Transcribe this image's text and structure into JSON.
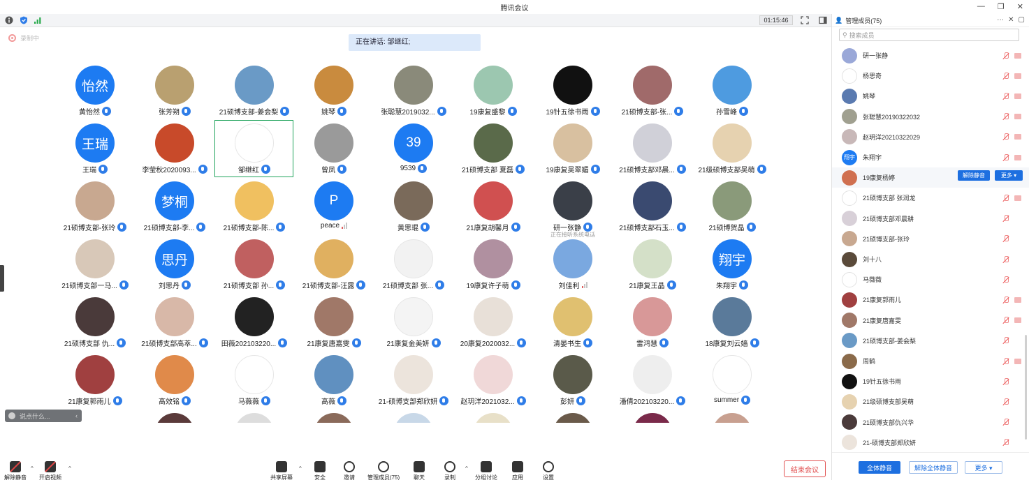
{
  "window": {
    "title": "腾讯会议"
  },
  "topbar": {
    "timer": "01:15:46"
  },
  "recording": {
    "label": "录制中"
  },
  "speaking": {
    "label": "正在讲话: 邹继红;"
  },
  "tiles": [
    {
      "name": "黄怡然",
      "avatar_text": "怡然",
      "color": "#1d7bf2"
    },
    {
      "name": "张芳朔",
      "color": "#b9a070"
    },
    {
      "name": "21硕博支部-姜会梨",
      "color": "#6a9ac6"
    },
    {
      "name": "姚琴",
      "color": "#c98b3e"
    },
    {
      "name": "张聪慧2019032...",
      "color": "#8a8a7a"
    },
    {
      "name": "19康复盛黎",
      "color": "#9cc7b0"
    },
    {
      "name": "19针五徐书雨",
      "color": "#111111"
    },
    {
      "name": "21硕博支部-张...",
      "color": "#a06a6a"
    },
    {
      "name": "孙雪峰",
      "color": "#4e9be0"
    },
    {
      "name": "王瑞",
      "avatar_text": "王瑞",
      "color": "#1d7bf2"
    },
    {
      "name": "李莹秋2020093...",
      "color": "#c84a2a"
    },
    {
      "name": "邹继红",
      "color": "#ffffff"
    },
    {
      "name": "曾凤",
      "color": "#9a9a9a"
    },
    {
      "name": "9539",
      "avatar_text": "39",
      "color": "#1d7bf2"
    },
    {
      "name": "21硕博支部 夏磊",
      "color": "#5a6a4a"
    },
    {
      "name": "19康复吴翠媚",
      "color": "#d8c0a0"
    },
    {
      "name": "21硕博支部邓晨...",
      "color": "#d0d0d8"
    },
    {
      "name": "21级硕博支部吴萌",
      "color": "#e6d2b0"
    },
    {
      "name": "21硕博支部-张玲",
      "color": "#c8a890"
    },
    {
      "name": "21硕博支部-李...",
      "avatar_text": "梦桐",
      "color": "#1d7bf2"
    },
    {
      "name": "21硕博支部-陈...",
      "color": "#f0c060"
    },
    {
      "name": "peace",
      "avatar_text": "P",
      "color": "#1d7bf2"
    },
    {
      "name": "黄思琨",
      "color": "#7a6a5a"
    },
    {
      "name": "21康复胡馨月",
      "color": "#d05050"
    },
    {
      "name": "研一张静",
      "sub": "正在接听系统电话",
      "color": "#3a3f48"
    },
    {
      "name": "21硕博支部石玉...",
      "color": "#3a4a70"
    },
    {
      "name": "21硕博贺晶",
      "color": "#8a9a7a"
    },
    {
      "name": "21硕博支部一马...",
      "color": "#d8c8b8"
    },
    {
      "name": "刘思丹",
      "avatar_text": "思丹",
      "color": "#1d7bf2"
    },
    {
      "name": "21硕博支部 孙...",
      "color": "#c06060"
    },
    {
      "name": "21硕博支部-汪露",
      "color": "#e0b060"
    },
    {
      "name": "21硕博支部 张...",
      "color": "#f2f2f2"
    },
    {
      "name": "19康复许子萌",
      "color": "#b090a0"
    },
    {
      "name": "刘佳利",
      "color": "#7aa8e0"
    },
    {
      "name": "21康复王晶",
      "color": "#d4e0c8"
    },
    {
      "name": "朱翔宇",
      "avatar_text": "翔宇",
      "color": "#1d7bf2"
    },
    {
      "name": "21硕博支部 仇...",
      "color": "#4a3a3a"
    },
    {
      "name": "21硕博支部高萃...",
      "color": "#d8b8a8"
    },
    {
      "name": "田薇202103220...",
      "color": "#222222"
    },
    {
      "name": "21康复唐嘉雯",
      "color": "#a07868"
    },
    {
      "name": "21康复金美妍",
      "color": "#f4f4f4"
    },
    {
      "name": "20康复2020032...",
      "color": "#e8e0d8"
    },
    {
      "name": "清晏书生",
      "color": "#e0c070"
    },
    {
      "name": "雷鸿慧",
      "color": "#d89898"
    },
    {
      "name": "18康复刘云嫱",
      "color": "#5a7a9a"
    },
    {
      "name": "21康复郭雨儿",
      "color": "#a04040"
    },
    {
      "name": "高效铭",
      "color": "#e08a4a"
    },
    {
      "name": "马薇薇",
      "color": "#ffffff"
    },
    {
      "name": "高薇",
      "color": "#6090c0"
    },
    {
      "name": "21-硕博支部郑欣妍",
      "color": "#ece4dc"
    },
    {
      "name": "赵玥洋2021032...",
      "color": "#f0d8d8"
    },
    {
      "name": "彭妍",
      "color": "#5a5a4a"
    },
    {
      "name": "潘倩202103220...",
      "color": "#eeeeee"
    },
    {
      "name": "summer",
      "color": "#ffffff"
    }
  ],
  "chat": {
    "placeholder": "说点什么..."
  },
  "toolbar": {
    "unmute": "解除静音",
    "video": "开启视频",
    "share": "共享屏幕",
    "security": "安全",
    "invite": "邀请",
    "members": "管理成员(75)",
    "chat": "聊天",
    "record": "录制",
    "breakout": "分组讨论",
    "apps": "应用",
    "settings": "设置",
    "end": "结束会议"
  },
  "panel": {
    "title": "管理成员(75)",
    "search_placeholder": "搜索成员",
    "members": [
      {
        "name": "研一张静",
        "color": "#9aa8d8"
      },
      {
        "name": "杨思奇",
        "color": "#ffffff"
      },
      {
        "name": "姚琴",
        "color": "#5a7ab0"
      },
      {
        "name": "张聪慧20190322032",
        "color": "#a0a090"
      },
      {
        "name": "赵玥洋20210322029",
        "color": "#c8b8b8"
      },
      {
        "name": "朱翔宇",
        "avatar_text": "翔宇"
      },
      {
        "name": "19康复杨婷",
        "color": "#d07050",
        "unmute_label": "解除静音",
        "more_label": "更多 ▾"
      },
      {
        "name": "21硕博支部 张润龙",
        "color": "#ffffff"
      },
      {
        "name": "21硕博支部邓晨耕",
        "color": "#d8d0d8"
      },
      {
        "name": "21硕博支部-张玲",
        "color": "#c8a890"
      },
      {
        "name": "刘十八",
        "color": "#5a4a3a"
      },
      {
        "name": "马薇薇",
        "color": "#ffffff"
      },
      {
        "name": "21康复郭雨儿",
        "color": "#a04040"
      },
      {
        "name": "21康复唐嘉雯",
        "color": "#a07868"
      },
      {
        "name": "21硕博支部-姜会梨",
        "color": "#6a9ac6"
      },
      {
        "name": "周鹤",
        "color": "#8a6a4a"
      },
      {
        "name": "19针五徐书雨",
        "color": "#111111"
      },
      {
        "name": "21级硕博支部吴萌",
        "color": "#e6d2b0"
      },
      {
        "name": "21硕博支部仇兴华",
        "color": "#4a3a3a"
      },
      {
        "name": "21-硕博支部郑欣妍",
        "color": "#ece4dc"
      }
    ],
    "footer": {
      "mute_all": "全体静音",
      "unmute_all": "解除全体静音",
      "more": "更多 ▾"
    }
  }
}
